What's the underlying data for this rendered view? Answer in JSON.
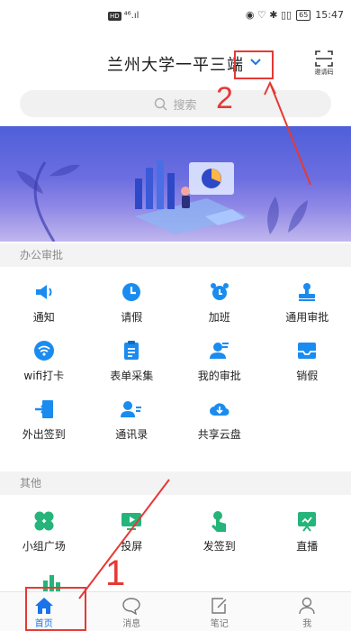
{
  "status_bar": {
    "hd": "HD",
    "signal": "⁴⁶.ıl",
    "icons": "◉ ♡ ✱ ▯▯",
    "battery": "65",
    "time": "15:47"
  },
  "header": {
    "org_name": "兰州大学一平三端",
    "scan_label": "邀请码"
  },
  "search": {
    "placeholder": "搜索"
  },
  "annotations": {
    "num_2": "2",
    "num_1": "1"
  },
  "sections": [
    {
      "title": "办公审批",
      "apps": [
        {
          "label": "通知",
          "icon": "speaker-icon"
        },
        {
          "label": "请假",
          "icon": "clock-icon"
        },
        {
          "label": "加班",
          "icon": "alarm-clock-icon"
        },
        {
          "label": "通用审批",
          "icon": "approval-stamp-icon"
        },
        {
          "label": "wifi打卡",
          "icon": "wifi-icon"
        },
        {
          "label": "表单采集",
          "icon": "clipboard-icon"
        },
        {
          "label": "我的审批",
          "icon": "user-approval-icon"
        },
        {
          "label": "销假",
          "icon": "inbox-icon"
        },
        {
          "label": "外出签到",
          "icon": "exit-door-icon"
        },
        {
          "label": "通讯录",
          "icon": "contacts-icon"
        },
        {
          "label": "共享云盘",
          "icon": "cloud-icon"
        }
      ]
    },
    {
      "title": "其他",
      "apps": [
        {
          "label": "小组广场",
          "icon": "group-square-icon"
        },
        {
          "label": "投屏",
          "icon": "screen-cast-icon"
        },
        {
          "label": "发签到",
          "icon": "tap-checkin-icon"
        },
        {
          "label": "直播",
          "icon": "live-broadcast-icon"
        }
      ]
    }
  ],
  "tabbar": [
    {
      "label": "首页",
      "icon": "home-icon",
      "active": true
    },
    {
      "label": "消息",
      "icon": "message-bubble-icon",
      "active": false
    },
    {
      "label": "笔记",
      "icon": "note-edit-icon",
      "active": false
    },
    {
      "label": "我",
      "icon": "person-icon",
      "active": false
    }
  ],
  "colors": {
    "accent": "#1a73e8",
    "app_blue": "#1a8cf0",
    "app_green": "#25b47a",
    "annotation_red": "#e53935"
  }
}
